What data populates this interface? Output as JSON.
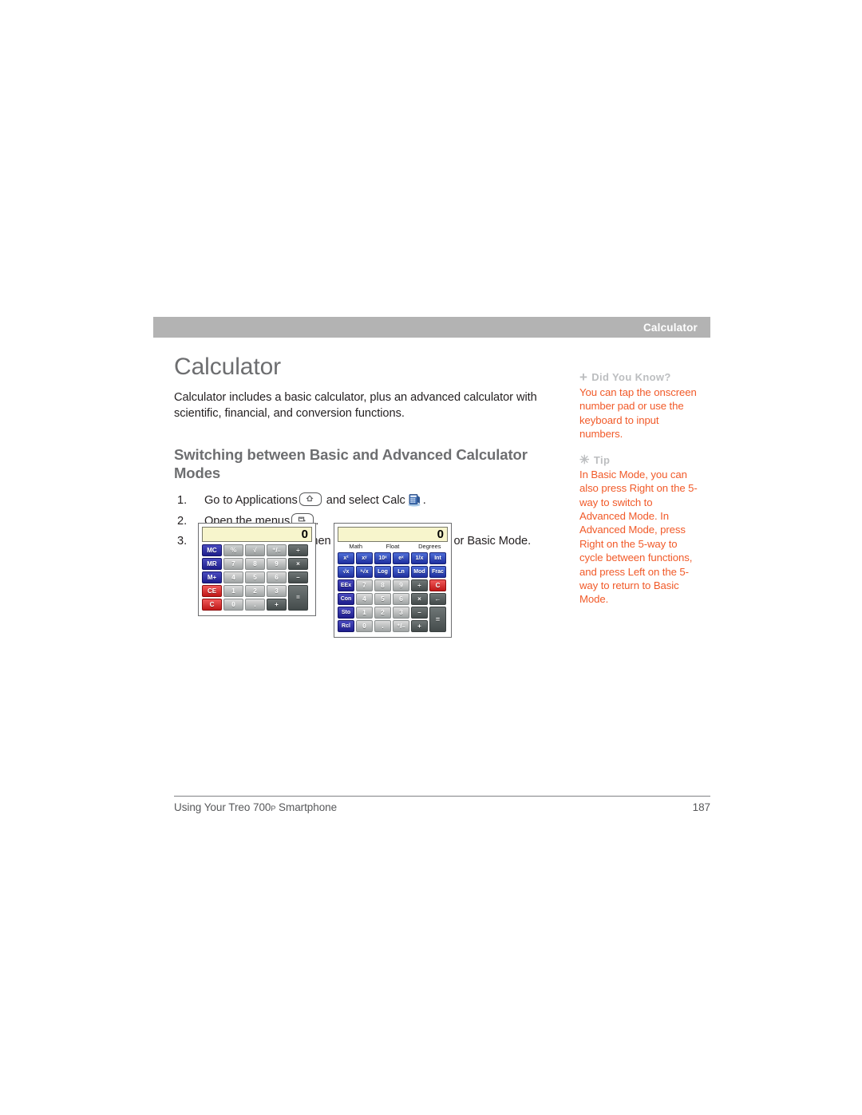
{
  "running_head": {
    "title": "Calculator"
  },
  "page": {
    "title": "Calculator",
    "intro": "Calculator includes a basic calculator, plus an advanced calculator with scientific, financial, and conversion functions.",
    "section_heading": "Switching between Basic and Advanced Calculator Modes"
  },
  "steps": [
    {
      "num": "1.",
      "before": "Go to Applications",
      "icon1": "home-key-icon",
      "middle": "and select Calc",
      "icon2": "calc-app-icon",
      "after": "."
    },
    {
      "num": "2.",
      "before": "Open the menus",
      "icon1": "menu-key-icon",
      "middle": "",
      "after": "."
    },
    {
      "num": "3.",
      "before": "Select Options, and then select Advanced Mode or Basic Mode.",
      "after": ""
    }
  ],
  "sidebar": {
    "notes": [
      {
        "glyph": "plus-icon",
        "glyph_char": "+",
        "heading": "Did You Know?",
        "body": "You can tap the onscreen number pad or use the keyboard to input numbers."
      },
      {
        "glyph": "asterisk-icon",
        "glyph_char": "✳",
        "heading": "Tip",
        "body": "In Basic Mode, you can also press Right on the 5-way to switch to Advanced Mode. In Advanced Mode, press Right on the 5-way to cycle between functions, and press Left on the 5-way to return to Basic Mode."
      }
    ]
  },
  "figures": {
    "basic_calculator": {
      "display": "0",
      "rows": [
        [
          {
            "label": "MC",
            "kind": "mem"
          },
          {
            "label": "%",
            "kind": "fn"
          },
          {
            "label": "√",
            "kind": "fn"
          },
          {
            "label": "⁺/₋",
            "kind": "fn"
          },
          {
            "label": "÷",
            "kind": "op"
          }
        ],
        [
          {
            "label": "MR",
            "kind": "mem"
          },
          {
            "label": "7",
            "kind": "num"
          },
          {
            "label": "8",
            "kind": "num"
          },
          {
            "label": "9",
            "kind": "num"
          },
          {
            "label": "×",
            "kind": "op"
          }
        ],
        [
          {
            "label": "M+",
            "kind": "mem"
          },
          {
            "label": "4",
            "kind": "num"
          },
          {
            "label": "5",
            "kind": "num"
          },
          {
            "label": "6",
            "kind": "num"
          },
          {
            "label": "–",
            "kind": "op"
          }
        ],
        [
          {
            "label": "CE",
            "kind": "red"
          },
          {
            "label": "1",
            "kind": "num"
          },
          {
            "label": "2",
            "kind": "num"
          },
          {
            "label": "3",
            "kind": "num"
          },
          {
            "label": "=",
            "kind": "eq"
          }
        ],
        [
          {
            "label": "C",
            "kind": "red"
          },
          {
            "label": "0",
            "kind": "num"
          },
          {
            "label": ".",
            "kind": "num"
          },
          {
            "label": "+",
            "kind": "op"
          }
        ]
      ]
    },
    "advanced_calculator": {
      "display": "0",
      "modes": {
        "left": "Math",
        "center": "Float",
        "right": "Degrees"
      },
      "rows": [
        [
          {
            "label": "x²",
            "kind": "fn"
          },
          {
            "label": "xʸ",
            "kind": "fn"
          },
          {
            "label": "10ˣ",
            "kind": "fn"
          },
          {
            "label": "eˣ",
            "kind": "fn"
          },
          {
            "label": "1/x",
            "kind": "fn"
          },
          {
            "label": "Int",
            "kind": "fn"
          }
        ],
        [
          {
            "label": "√x",
            "kind": "fn"
          },
          {
            "label": "ˣ√x",
            "kind": "fn"
          },
          {
            "label": "Log",
            "kind": "fn"
          },
          {
            "label": "Ln",
            "kind": "fn"
          },
          {
            "label": "Mod",
            "kind": "fn"
          },
          {
            "label": "Frac",
            "kind": "fn"
          }
        ],
        [
          {
            "label": "EEx",
            "kind": "mem"
          },
          {
            "label": "7",
            "kind": "num"
          },
          {
            "label": "8",
            "kind": "num"
          },
          {
            "label": "9",
            "kind": "num"
          },
          {
            "label": "÷",
            "kind": "op"
          },
          {
            "label": "C",
            "kind": "red"
          }
        ],
        [
          {
            "label": "Con",
            "kind": "mem"
          },
          {
            "label": "4",
            "kind": "num"
          },
          {
            "label": "5",
            "kind": "num"
          },
          {
            "label": "6",
            "kind": "num"
          },
          {
            "label": "×",
            "kind": "op"
          },
          {
            "label": "←",
            "kind": "op"
          }
        ],
        [
          {
            "label": "Sto",
            "kind": "mem"
          },
          {
            "label": "1",
            "kind": "num"
          },
          {
            "label": "2",
            "kind": "num"
          },
          {
            "label": "3",
            "kind": "num"
          },
          {
            "label": "–",
            "kind": "op"
          },
          {
            "label": "=",
            "kind": "eq"
          }
        ],
        [
          {
            "label": "Rcl",
            "kind": "mem"
          },
          {
            "label": "0",
            "kind": "num"
          },
          {
            "label": ".",
            "kind": "num"
          },
          {
            "label": "⁺/₋",
            "kind": "num"
          },
          {
            "label": "+",
            "kind": "op"
          }
        ]
      ]
    }
  },
  "footer": {
    "book_title_before": "Using Your Treo 700",
    "book_title_sub": "P",
    "book_title_after": " Smartphone",
    "page_number": "187"
  },
  "colors": {
    "heading_gray": "#6d6e70",
    "body_black": "#231f20",
    "note_orange": "#f15a29",
    "note_label_gray": "#bcbec0",
    "header_bar_gray": "#b3b3b3",
    "display_yellow": "#f7f5cc"
  }
}
